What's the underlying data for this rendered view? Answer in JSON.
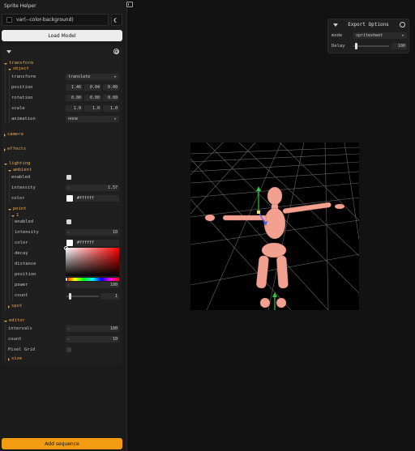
{
  "app": {
    "title": "Sprite Helper"
  },
  "background_color": {
    "value": "var(--color-background)"
  },
  "buttons": {
    "load_model": "Load Model",
    "add_sequence": "Add sequence"
  },
  "transform": {
    "folder_label": "transform",
    "object_label": "object",
    "transform_label": "transform",
    "transform_mode": "translate",
    "position_label": "position",
    "position": [
      "1.46",
      "0.04",
      "0.00"
    ],
    "rotation_label": "rotation",
    "rotation": [
      "0.00",
      "0.00",
      "0.00"
    ],
    "scale_label": "scale",
    "scale": [
      "1.0",
      "1.0",
      "1.0"
    ],
    "animation_label": "animation",
    "animation": "none"
  },
  "camera": {
    "label": "camera"
  },
  "effects": {
    "label": "effects"
  },
  "lighting": {
    "label": "lighting",
    "ambient": {
      "label": "ambient",
      "enabled_label": "enabled",
      "enabled": true,
      "intensity_label": "intensity",
      "intensity": "1.57",
      "color_label": "color",
      "color": "#ffffff"
    },
    "point": {
      "label": "point",
      "item_label": "1",
      "enabled_label": "enabled",
      "enabled": true,
      "intensity_label": "intensity",
      "intensity": "10",
      "color_label": "color",
      "color": "#ffffff",
      "decay_label": "decay",
      "distance_label": "distance",
      "position_label": "position",
      "power_label": "power",
      "power": "100",
      "count_label": "count",
      "count": "1",
      "count_fraction": 0.07
    },
    "spot": {
      "label": "spot"
    }
  },
  "editor": {
    "label": "editor",
    "intervals_label": "intervals",
    "intervals": "100",
    "count_label": "count",
    "count": "10",
    "pixel_grid_label": "Pixel Grid",
    "pixel_grid": false,
    "size_label": "size"
  },
  "export_options": {
    "title": "Export Options",
    "mode_label": "mode",
    "mode": "spritesheet",
    "delay_label": "Delay",
    "delay": "100",
    "delay_fraction": 0.05
  },
  "colors": {
    "accent": "#e8a64b",
    "add_sequence": "#f39c12",
    "model": "#f2a190",
    "axis_y": "#2ecc40",
    "axis_z": "#3b5bff"
  },
  "icons": [
    "sidebar-toggle-icon",
    "moon-icon",
    "gear-icon",
    "chevron-down-icon",
    "chevron-right-icon"
  ]
}
